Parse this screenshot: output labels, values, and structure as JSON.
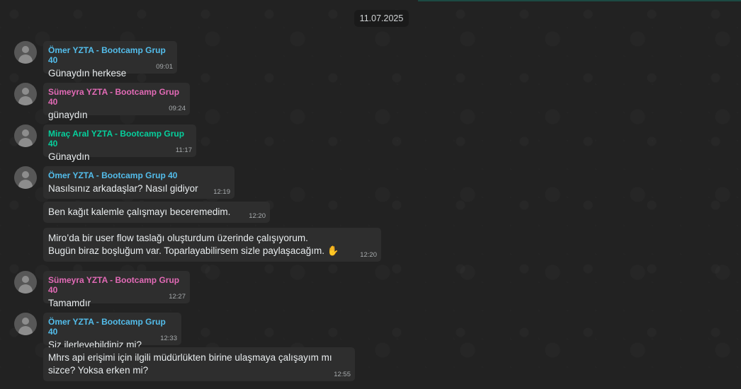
{
  "chat": {
    "date_separator": "11.07.2025",
    "colors": {
      "sender_omer": "#53bdeb",
      "sender_sumeyra": "#e26ab6",
      "sender_mirac": "#06cf9c"
    },
    "messages": [
      {
        "sender": "Ömer YZTA - Bootcamp Grup 40",
        "text": "Günaydın herkese",
        "time": "09:01"
      },
      {
        "sender": "Sümeyra YZTA - Bootcamp Grup 40",
        "text": "günaydın",
        "time": "09:24"
      },
      {
        "sender": "Miraç Aral YZTA - Bootcamp Grup 40",
        "text": "Günaydın",
        "time": "11:17"
      },
      {
        "sender": "Ömer YZTA - Bootcamp Grup 40",
        "text": "Nasılsınız arkadaşlar? Nasıl gidiyor",
        "time": "12:19"
      },
      {
        "sender": "",
        "text": "Ben kağıt kalemle çalışmayı beceremedim.",
        "time": "12:20"
      },
      {
        "sender": "",
        "text": "Miro’da bir user flow taslağı oluşturdum üzerinde çalışıyorum.",
        "text2": "Bugün biraz boşluğum var. Toparlayabilirsem sizle paylaşacağım.",
        "emoji": "✋",
        "time": "12:20"
      },
      {
        "sender": "Sümeyra YZTA - Bootcamp Grup 40",
        "text": "Tamamdır",
        "time": "12:27"
      },
      {
        "sender": "Ömer YZTA - Bootcamp Grup 40",
        "text": "Siz ilerleyebildiniz mi?",
        "time": "12:33"
      },
      {
        "sender": "",
        "text": "Mhrs api erişimi için ilgili müdürlükten birine ulaşmaya çalışayım mı",
        "text2": "sizce? Yoksa erken mi?",
        "time": "12:55"
      }
    ]
  }
}
